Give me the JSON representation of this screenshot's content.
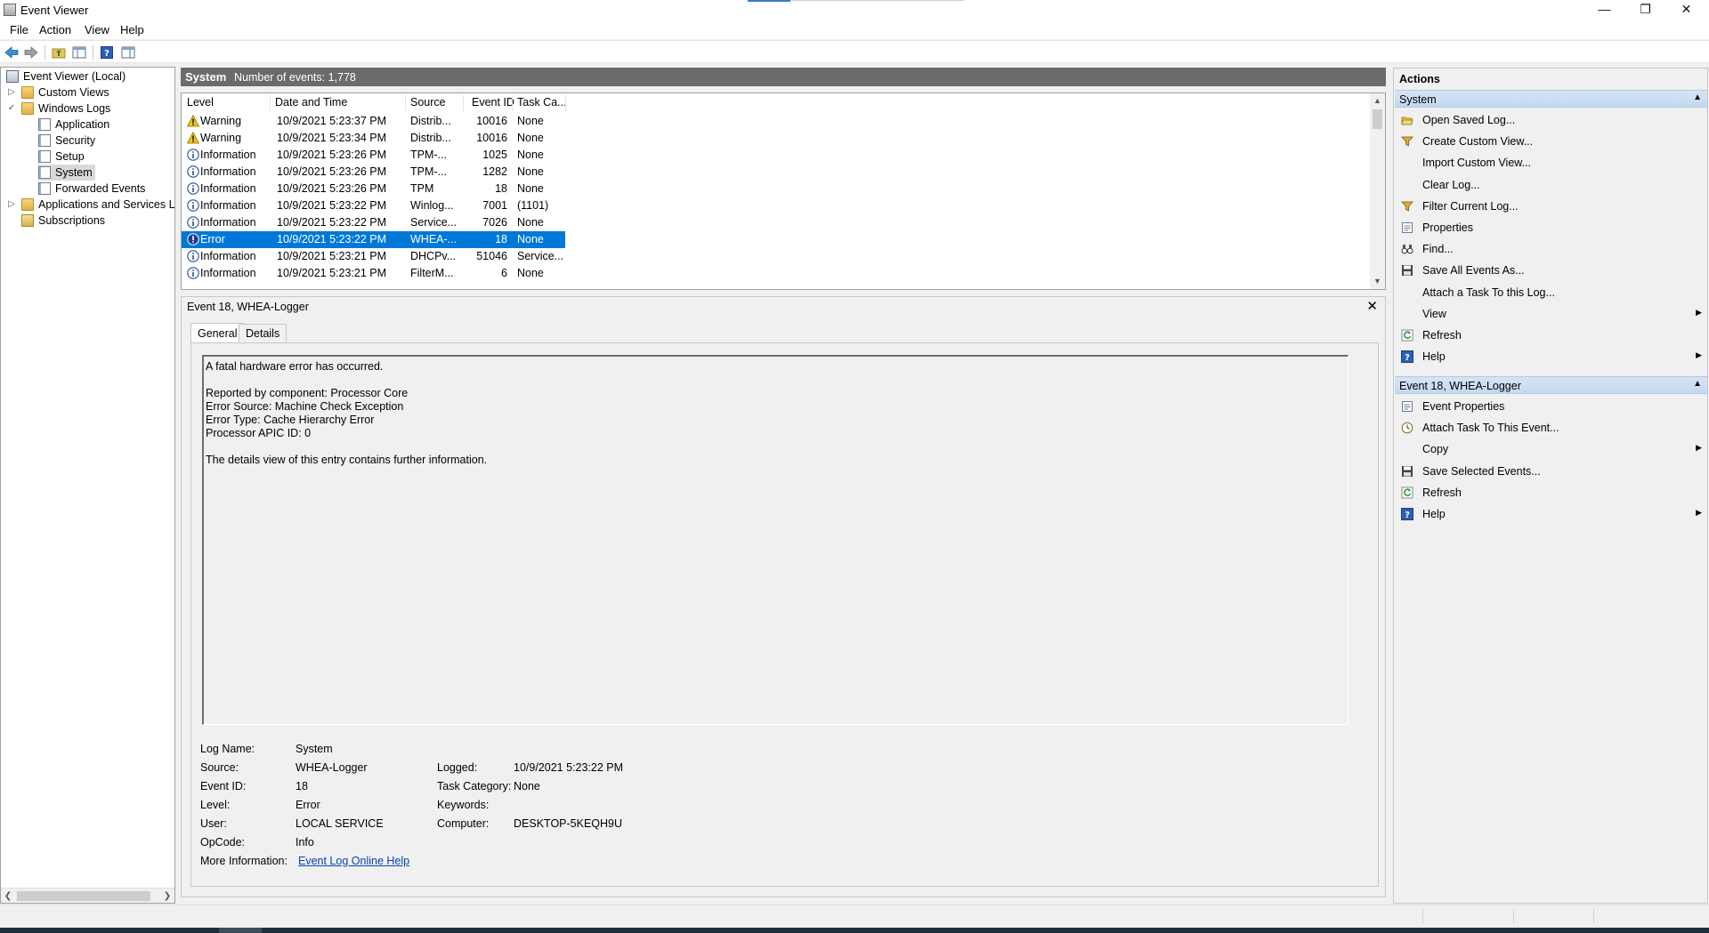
{
  "window": {
    "title": "Event Viewer",
    "minimize_icon": "minimize-icon",
    "restore_icon": "restore-icon",
    "close_icon": "close-icon"
  },
  "menu": {
    "file": "File",
    "action": "Action",
    "view": "View",
    "help": "Help"
  },
  "toolbar": {
    "icons": [
      "back-arrow-icon",
      "forward-arrow-icon",
      "up-folder-icon",
      "show-hide-tree-icon",
      "help-icon",
      "show-hide-action-pane-icon"
    ]
  },
  "tree": {
    "root": "Event Viewer (Local)",
    "custom_views": "Custom Views",
    "windows_logs": "Windows Logs",
    "application": "Application",
    "security": "Security",
    "setup": "Setup",
    "system": "System",
    "forwarded": "Forwarded Events",
    "apps_services": "Applications and Services Lo",
    "subscriptions": "Subscriptions"
  },
  "center": {
    "log_name": "System",
    "count_text": "Number of events: 1,778"
  },
  "grid": {
    "columns": [
      "Level",
      "Date and Time",
      "Source",
      "Event ID",
      "Task Ca..."
    ],
    "rows": [
      {
        "level": "Warning",
        "icon": "warning-icon",
        "date": "10/9/2021 5:23:37 PM",
        "source": "Distrib...",
        "id": "10016",
        "task": "None"
      },
      {
        "level": "Warning",
        "icon": "warning-icon",
        "date": "10/9/2021 5:23:34 PM",
        "source": "Distrib...",
        "id": "10016",
        "task": "None"
      },
      {
        "level": "Information",
        "icon": "info-icon",
        "date": "10/9/2021 5:23:26 PM",
        "source": "TPM-...",
        "id": "1025",
        "task": "None"
      },
      {
        "level": "Information",
        "icon": "info-icon",
        "date": "10/9/2021 5:23:26 PM",
        "source": "TPM-...",
        "id": "1282",
        "task": "None"
      },
      {
        "level": "Information",
        "icon": "info-icon",
        "date": "10/9/2021 5:23:26 PM",
        "source": "TPM",
        "id": "18",
        "task": "None"
      },
      {
        "level": "Information",
        "icon": "info-icon",
        "date": "10/9/2021 5:23:22 PM",
        "source": "Winlog...",
        "id": "7001",
        "task": "(1101)"
      },
      {
        "level": "Information",
        "icon": "info-icon",
        "date": "10/9/2021 5:23:22 PM",
        "source": "Service...",
        "id": "7026",
        "task": "None"
      },
      {
        "level": "Error",
        "icon": "error-icon",
        "date": "10/9/2021 5:23:22 PM",
        "source": "WHEA-...",
        "id": "18",
        "task": "None"
      },
      {
        "level": "Information",
        "icon": "info-icon",
        "date": "10/9/2021 5:23:21 PM",
        "source": "DHCPv...",
        "id": "51046",
        "task": "Service..."
      },
      {
        "level": "Information",
        "icon": "info-icon",
        "date": "10/9/2021 5:23:21 PM",
        "source": "FilterM...",
        "id": "6",
        "task": "None"
      }
    ],
    "selected_index": 7
  },
  "detail": {
    "title": "Event 18, WHEA-Logger",
    "tabs": [
      "General",
      "Details"
    ],
    "active_tab": "General",
    "description": [
      "A fatal hardware error has occurred.",
      "",
      "Reported by component: Processor Core",
      "Error Source: Machine Check Exception",
      "Error Type: Cache Hierarchy Error",
      "Processor APIC ID: 0",
      "",
      "The details view of this entry contains further information."
    ],
    "props": {
      "log_name_label": "Log Name:",
      "log_name": "System",
      "source_label": "Source:",
      "source": "WHEA-Logger",
      "logged_label": "Logged:",
      "logged": "10/9/2021 5:23:22 PM",
      "event_id_label": "Event ID:",
      "event_id": "18",
      "task_cat_label": "Task Category:",
      "task_cat": "None",
      "level_label": "Level:",
      "level": "Error",
      "keywords_label": "Keywords:",
      "keywords": "",
      "user_label": "User:",
      "user": "LOCAL SERVICE",
      "computer_label": "Computer:",
      "computer": "DESKTOP-5KEQH9U",
      "opcode_label": "OpCode:",
      "opcode": "Info",
      "more_info_label": "More Information:",
      "more_info_link": "Event Log Online Help"
    }
  },
  "actions": {
    "title": "Actions",
    "section1": "System",
    "section1_items": [
      {
        "label": "Open Saved Log...",
        "icon": "open-folder-icon",
        "submenu": false
      },
      {
        "label": "Create Custom View...",
        "icon": "filter-icon",
        "submenu": false
      },
      {
        "label": "Import Custom View...",
        "icon": "",
        "submenu": false
      },
      {
        "label": "Clear Log...",
        "icon": "",
        "submenu": false
      },
      {
        "label": "Filter Current Log...",
        "icon": "filter-icon",
        "submenu": false
      },
      {
        "label": "Properties",
        "icon": "properties-icon",
        "submenu": false
      },
      {
        "label": "Find...",
        "icon": "binoculars-icon",
        "submenu": false
      },
      {
        "label": "Save All Events As...",
        "icon": "save-icon",
        "submenu": false
      },
      {
        "label": "Attach a Task To this Log...",
        "icon": "",
        "submenu": false
      },
      {
        "label": "View",
        "icon": "",
        "submenu": true
      },
      {
        "label": "Refresh",
        "icon": "refresh-icon",
        "submenu": false
      },
      {
        "label": "Help",
        "icon": "help-icon",
        "submenu": true
      }
    ],
    "section2": "Event 18, WHEA-Logger",
    "section2_items": [
      {
        "label": "Event Properties",
        "icon": "properties-icon",
        "submenu": false
      },
      {
        "label": "Attach Task To This Event...",
        "icon": "task-icon",
        "submenu": false
      },
      {
        "label": "Copy",
        "icon": "",
        "submenu": true
      },
      {
        "label": "Save Selected Events...",
        "icon": "save-icon",
        "submenu": false
      },
      {
        "label": "Refresh",
        "icon": "refresh-icon",
        "submenu": false
      },
      {
        "label": "Help",
        "icon": "help-icon",
        "submenu": true
      }
    ]
  },
  "colors": {
    "selection": "#0078d7",
    "header_gray": "#6b6b6b",
    "section_blue": "#c4d8ef",
    "link": "#0645ad"
  }
}
